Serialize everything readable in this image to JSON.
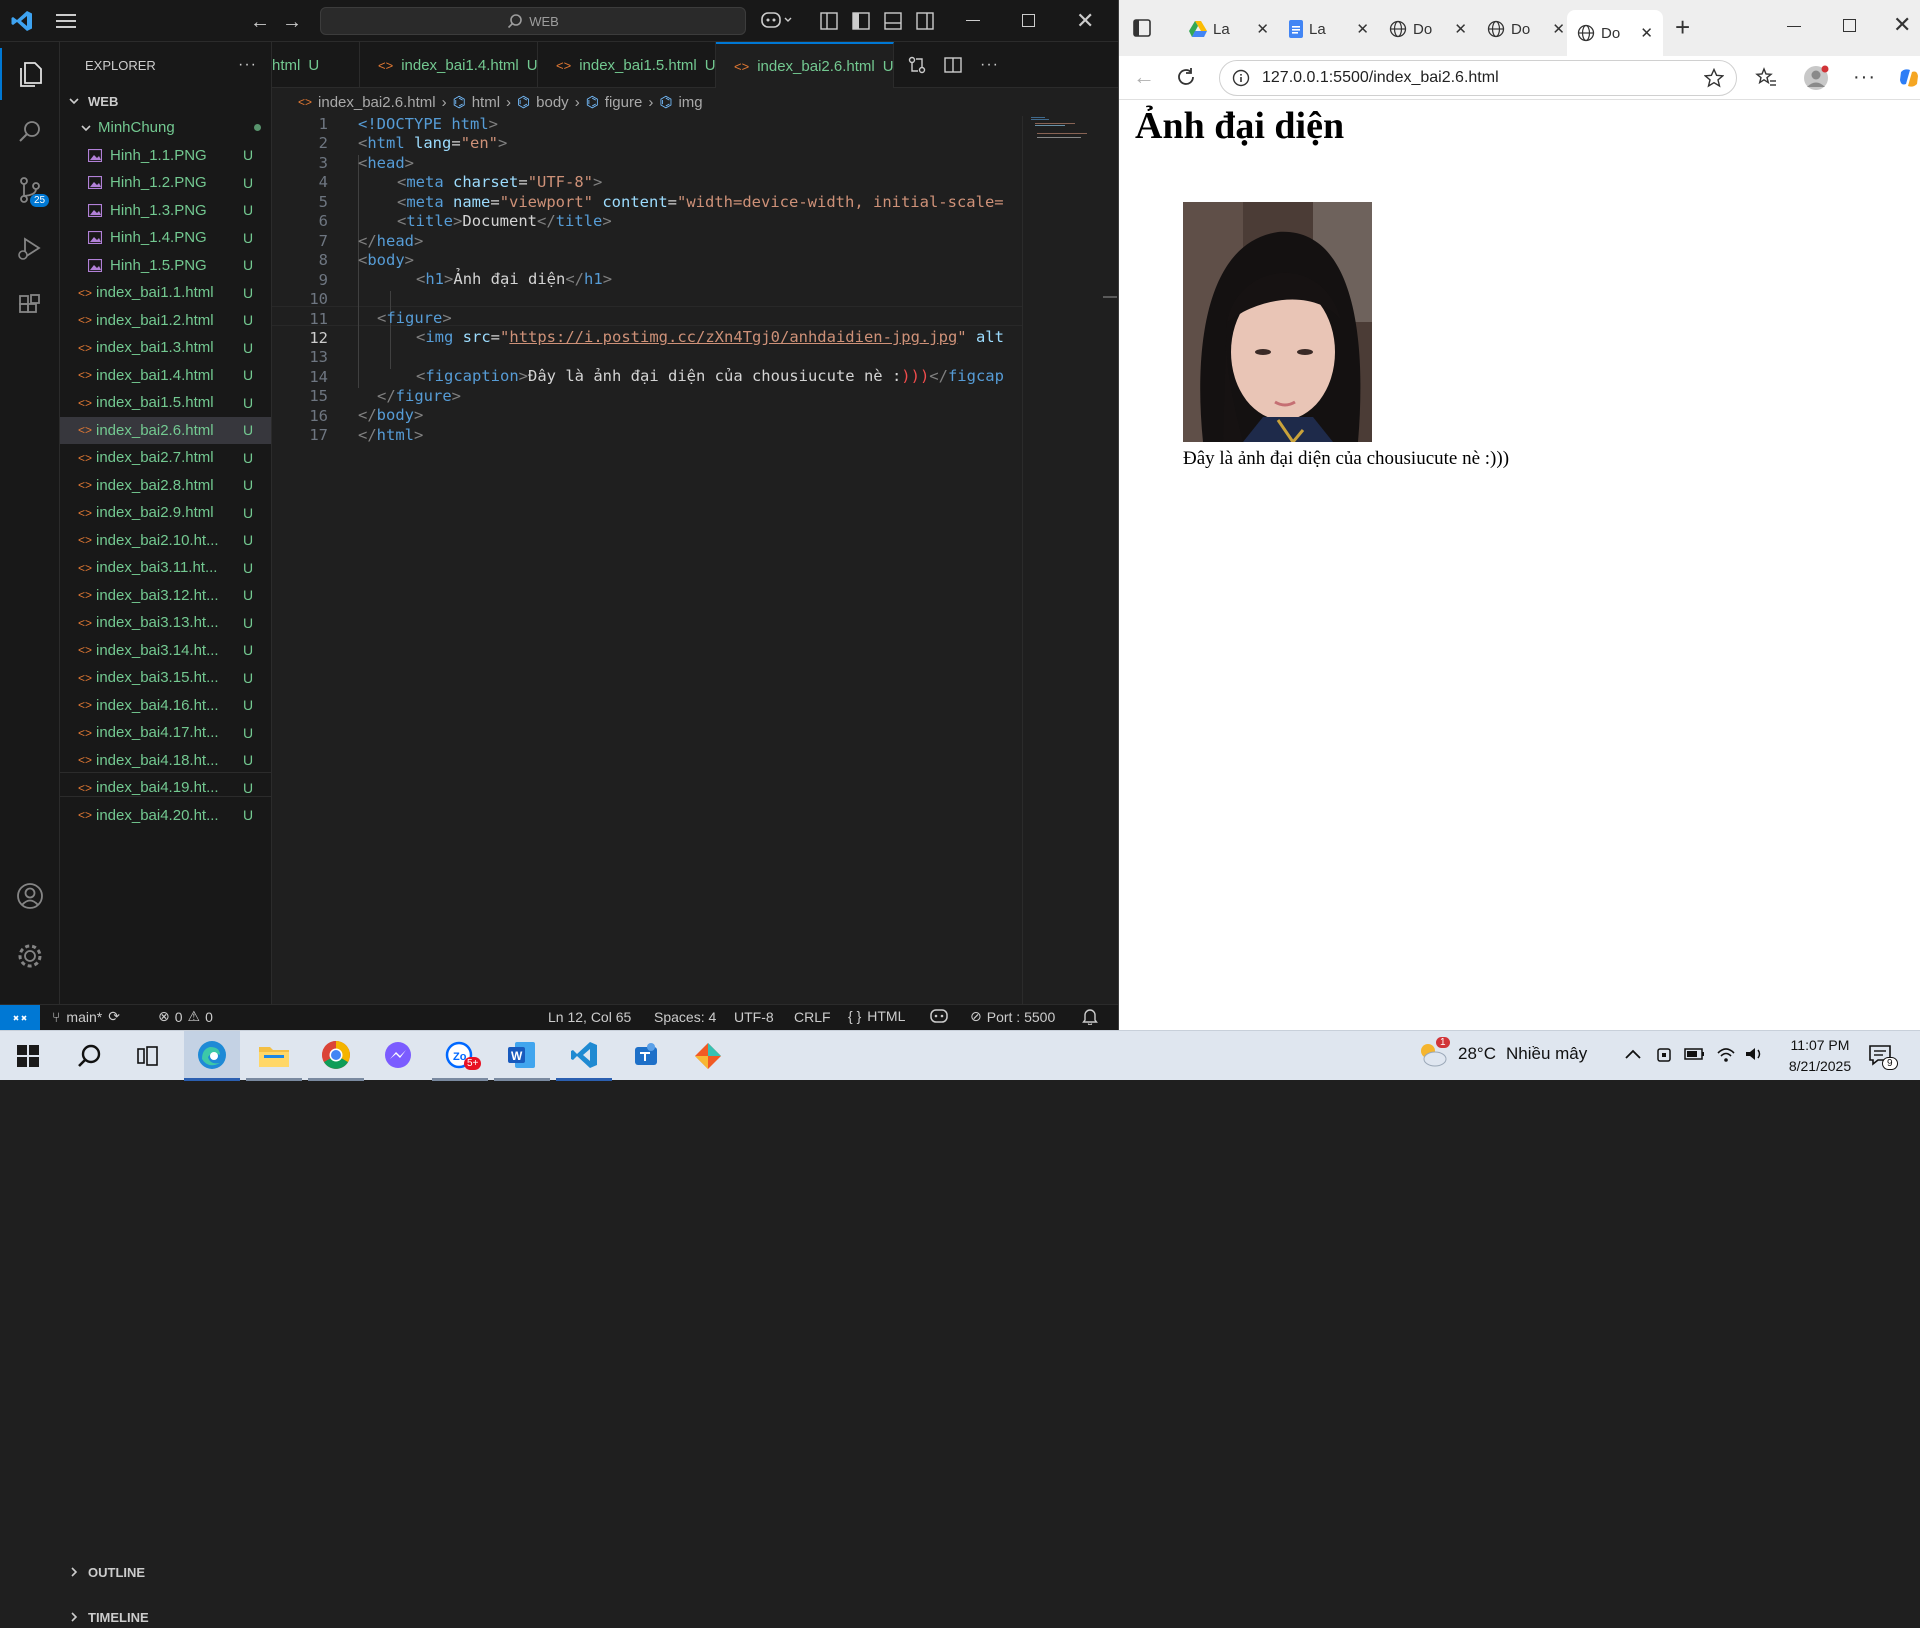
{
  "vscode": {
    "command_center": "WEB",
    "explorer": {
      "title": "EXPLORER",
      "section": "WEB",
      "folder": "MinhChung",
      "images": [
        "Hinh_1.1.PNG",
        "Hinh_1.2.PNG",
        "Hinh_1.3.PNG",
        "Hinh_1.4.PNG",
        "Hinh_1.5.PNG"
      ],
      "files": [
        "index_bai1.1.html",
        "index_bai1.2.html",
        "index_bai1.3.html",
        "index_bai1.4.html",
        "index_bai1.5.html",
        "index_bai2.6.html",
        "index_bai2.7.html",
        "index_bai2.8.html",
        "index_bai2.9.html",
        "index_bai2.10.ht...",
        "index_bai3.11.ht...",
        "index_bai3.12.ht...",
        "index_bai3.13.ht...",
        "index_bai3.14.ht...",
        "index_bai3.15.ht...",
        "index_bai4.16.ht...",
        "index_bai4.17.ht...",
        "index_bai4.18.ht...",
        "index_bai4.19.ht...",
        "index_bai4.20.ht..."
      ],
      "status_u": "U",
      "outline": "OUTLINE",
      "timeline": "TIMELINE",
      "badge": "25"
    },
    "tabs": [
      {
        "label": "html",
        "status": "U"
      },
      {
        "label": "index_bai1.4.html",
        "status": "U"
      },
      {
        "label": "index_bai1.5.html",
        "status": "U"
      },
      {
        "label": "index_bai2.6.html",
        "status": "U"
      }
    ],
    "breadcrumb": [
      "index_bai2.6.html",
      "html",
      "body",
      "figure",
      "img"
    ],
    "code": {
      "l1": {
        "a": "<!DOCTYPE ",
        "b": "html",
        "c": ">"
      },
      "l2": {
        "a": "<",
        "b": "html ",
        "c": "lang",
        "d": "=",
        "e": "\"en\"",
        "f": ">"
      },
      "l3": {
        "a": "<",
        "b": "head",
        "c": ">"
      },
      "l4": {
        "a": "<",
        "b": "meta ",
        "c": "charset",
        "d": "=",
        "e": "\"UTF-8\"",
        "f": ">"
      },
      "l5": {
        "a": "<",
        "b": "meta ",
        "c": "name",
        "d": "=",
        "e": "\"viewport\"",
        "f": " content",
        "g": "=",
        "h": "\"width=device-width, initial-scale="
      },
      "l6": {
        "a": "<",
        "b": "title",
        "c": ">",
        "d": "Document",
        "e": "</",
        "f": "title",
        "g": ">"
      },
      "l7": {
        "a": "</",
        "b": "head",
        "c": ">"
      },
      "l8": {
        "a": "<",
        "b": "body",
        "c": ">"
      },
      "l9": {
        "a": "<",
        "b": "h1",
        "c": ">",
        "d": "Ảnh đại diện",
        "e": "</",
        "f": "h1",
        "g": ">"
      },
      "l11": {
        "a": "<",
        "b": "figure",
        "c": ">"
      },
      "l12": {
        "a": "<",
        "b": "img ",
        "c": "src",
        "d": "=",
        "e": "\"",
        "f": "https://i.postimg.cc/zXn4Tgj0/anhdaidien-jpg.jpg",
        "g": "\"",
        "h": " alt"
      },
      "l14": {
        "a": "<",
        "b": "figcaption",
        "c": ">",
        "d": "Đây là ảnh đại diện của chousiucute nè :",
        "e": ")))",
        "f": "</",
        "g": "figcap"
      },
      "l15": {
        "a": "</",
        "b": "figure",
        "c": ">"
      },
      "l16": {
        "a": "</",
        "b": "body",
        "c": ">"
      },
      "l17": {
        "a": "</",
        "b": "html",
        "c": ">"
      }
    },
    "line_numbers": [
      "1",
      "2",
      "3",
      "4",
      "5",
      "6",
      "7",
      "8",
      "9",
      "10",
      "11",
      "12",
      "13",
      "14",
      "15",
      "16",
      "17"
    ],
    "status": {
      "branch": "main*",
      "problems": "0",
      "warnings": "0",
      "position": "Ln 12, Col 65",
      "spaces": "Spaces: 4",
      "encoding": "UTF-8",
      "eol": "CRLF",
      "language": "HTML",
      "port": "Port : 5500"
    }
  },
  "browser": {
    "tabs": [
      "La",
      "La",
      "Do",
      "Do",
      "Do"
    ],
    "url": "127.0.0.1:5500/index_bai2.6.html",
    "page": {
      "heading": "Ảnh đại diện",
      "caption": "Đây là ảnh đại diện của chousiucute nè :)))"
    }
  },
  "taskbar": {
    "temperature": "28°C",
    "weather": "Nhiều mây",
    "weather_badge": "1",
    "zalo_badge": "5+",
    "time": "11:07 PM",
    "date": "8/21/2025",
    "notification_count": "9"
  },
  "colors": {
    "accent": "#0078d4",
    "git_untracked": "#73c991",
    "editor_bg": "#1f1f1f",
    "sidebar_bg": "#181818"
  }
}
